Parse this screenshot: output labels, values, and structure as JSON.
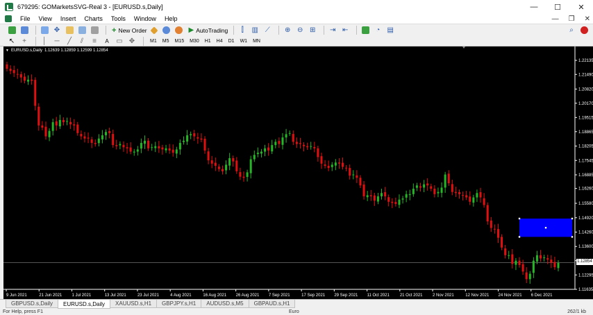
{
  "window": {
    "title": "679295: GOMarketsSVG-Real 3 - [EURUSD.s,Daily]",
    "controls": [
      "—",
      "☐",
      "✕"
    ]
  },
  "menu": {
    "items": [
      "File",
      "View",
      "Insert",
      "Charts",
      "Tools",
      "Window",
      "Help"
    ],
    "right_controls": [
      "—",
      "❐",
      "✕"
    ]
  },
  "toolbar": {
    "new_order": "New Order",
    "autotrading": "AutoTrading",
    "timeframes": [
      "M1",
      "M5",
      "M15",
      "M30",
      "H1",
      "H4",
      "D1",
      "W1",
      "MN"
    ]
  },
  "chart": {
    "symbol_header": "EURUSD.s,Daily",
    "ohlc": "1.12639 1.12859 1.12599 1.12854",
    "current_price": "1.12854",
    "colors": {
      "background": "#000000",
      "bull": "#26b526",
      "bear": "#e01010",
      "rectangle": "#0000ff",
      "axis_text": "#ffffff"
    }
  },
  "chart_data": {
    "type": "candlestick",
    "symbol": "EURUSD.s",
    "timeframe": "Daily",
    "ylim": [
      1.11635,
      1.22135
    ],
    "y_ticks": [
      "1.22135",
      "1.21490",
      "1.20820",
      "1.20170",
      "1.19515",
      "1.18865",
      "1.18205",
      "1.17545",
      "1.16885",
      "1.16260",
      "1.15580",
      "1.14920",
      "1.14260",
      "1.13600",
      "1.12950",
      "1.12295",
      "1.11635"
    ],
    "x_ticks": [
      "9 Jun 2021",
      "21 Jun 2021",
      "1 Jul 2021",
      "13 Jul 2021",
      "23 Jul 2021",
      "4 Aug 2021",
      "16 Aug 2021",
      "26 Aug 2021",
      "7 Sep 2021",
      "17 Sep 2021",
      "29 Sep 2021",
      "11 Oct 2021",
      "21 Oct 2021",
      "2 Nov 2021",
      "12 Nov 2021",
      "24 Nov 2021",
      "6 Dec 2021"
    ],
    "closes": [
      1.2175,
      1.2165,
      1.2155,
      1.215,
      1.2135,
      1.212,
      1.2125,
      1.212,
      1.2005,
      1.1915,
      1.1905,
      1.1865,
      1.189,
      1.193,
      1.1915,
      1.194,
      1.193,
      1.1935,
      1.192,
      1.1915,
      1.188,
      1.1865,
      1.1855,
      1.1855,
      1.1835,
      1.183,
      1.1855,
      1.187,
      1.1885,
      1.188,
      1.1825,
      1.182,
      1.183,
      1.1815,
      1.181,
      1.1795,
      1.1795,
      1.1805,
      1.1835,
      1.1845,
      1.181,
      1.1815,
      1.182,
      1.181,
      1.1805,
      1.181,
      1.18,
      1.179,
      1.1805,
      1.1835,
      1.1845,
      1.187,
      1.1875,
      1.1865,
      1.1855,
      1.185,
      1.18,
      1.1755,
      1.174,
      1.173,
      1.1715,
      1.1705,
      1.1735,
      1.1765,
      1.175,
      1.1705,
      1.168,
      1.1675,
      1.17,
      1.176,
      1.178,
      1.179,
      1.1795,
      1.181,
      1.18,
      1.1825,
      1.184,
      1.183,
      1.186,
      1.1875,
      1.188,
      1.184,
      1.183,
      1.183,
      1.182,
      1.1815,
      1.182,
      1.181,
      1.177,
      1.174,
      1.173,
      1.172,
      1.1735,
      1.1745,
      1.174,
      1.1725,
      1.172,
      1.1685,
      1.169,
      1.1675,
      1.164,
      1.159,
      1.1595,
      1.159,
      1.157,
      1.159,
      1.1605,
      1.159,
      1.1565,
      1.156,
      1.1555,
      1.1575,
      1.158,
      1.16,
      1.16,
      1.1625,
      1.164,
      1.163,
      1.1645,
      1.164,
      1.1625,
      1.16,
      1.161,
      1.163,
      1.169,
      1.165,
      1.161,
      1.1605,
      1.16,
      1.1595,
      1.1585,
      1.1565,
      1.1585,
      1.1605,
      1.1585,
      1.155,
      1.1475,
      1.1445,
      1.144,
      1.14,
      1.1355,
      1.132,
      1.132,
      1.128,
      1.1295,
      1.1275,
      1.1245,
      1.121,
      1.1235,
      1.1295,
      1.132,
      1.1305,
      1.131,
      1.13,
      1.1285,
      1.1265,
      1.1285
    ],
    "rectangle": {
      "price_top": 1.1488,
      "price_bottom": 1.1404,
      "start_index": 145,
      "end_index": 174
    }
  },
  "tabs": [
    "GBPUSD.s,Daily",
    "EURUSD.s,Daily",
    "XAUUSD.s,H1",
    "GBPJPY.s,H1",
    "AUDUSD.s,M5",
    "GBPAUD.s,H1"
  ],
  "active_tab": "EURUSD.s,Daily",
  "status": {
    "help": "For Help, press F1",
    "profile": "Euro",
    "connection": "262/1 kb"
  }
}
